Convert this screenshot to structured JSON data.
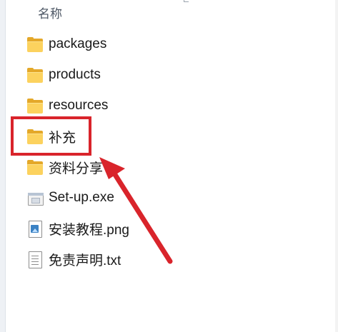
{
  "explorer": {
    "column_header": "名称",
    "files": [
      {
        "name": "packages",
        "type": "folder",
        "icon": "folder-icon"
      },
      {
        "name": "products",
        "type": "folder",
        "icon": "folder-icon"
      },
      {
        "name": "resources",
        "type": "folder",
        "icon": "folder-icon"
      },
      {
        "name": "补充",
        "type": "folder",
        "icon": "folder-icon"
      },
      {
        "name": "资料分享",
        "type": "folder",
        "icon": "folder-icon"
      },
      {
        "name": "Set-up.exe",
        "type": "exe",
        "icon": "exe-icon"
      },
      {
        "name": "安装教程.png",
        "type": "image",
        "icon": "image-file-icon"
      },
      {
        "name": "免责声明.txt",
        "type": "text",
        "icon": "text-file-icon"
      }
    ]
  },
  "annotation": {
    "highlighted_item": "补充",
    "color": "#d9242b"
  }
}
